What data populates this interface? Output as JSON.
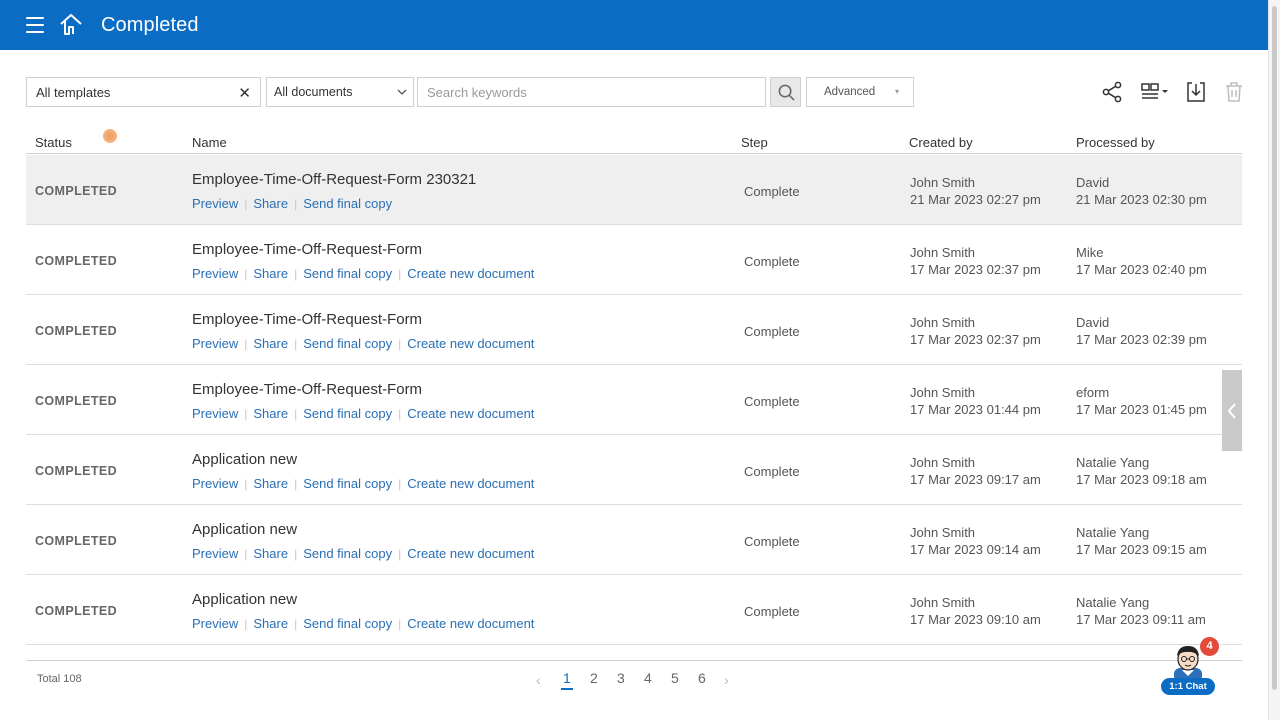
{
  "header": {
    "title": "Completed",
    "background": "#0b6cc4"
  },
  "filters": {
    "templates_value": "All templates",
    "clear_icon": "close-icon",
    "documents_value": "All documents",
    "search_placeholder": "Search keywords",
    "advanced_label": "Advanced"
  },
  "toolbar": {
    "icons": [
      "share-icon",
      "layout-view-icon",
      "download-icon",
      "trash-icon"
    ]
  },
  "table": {
    "columns": {
      "status": "Status",
      "name": "Name",
      "step": "Step",
      "created_by": "Created by",
      "processed_by": "Processed by"
    },
    "rows": [
      {
        "status": "COMPLETED",
        "name": "Employee-Time-Off-Request-Form 230321",
        "links": [
          "Preview",
          "Share",
          "Send final copy"
        ],
        "step": "Complete",
        "created_by": "John Smith",
        "created_at": "21 Mar 2023 02:27 pm",
        "processed_by": "David",
        "processed_at": "21 Mar 2023 02:30 pm"
      },
      {
        "status": "COMPLETED",
        "name": "Employee-Time-Off-Request-Form",
        "links": [
          "Preview",
          "Share",
          "Send final copy",
          "Create new document"
        ],
        "step": "Complete",
        "created_by": "John Smith",
        "created_at": "17 Mar 2023 02:37 pm",
        "processed_by": "Mike",
        "processed_at": "17 Mar 2023 02:40 pm"
      },
      {
        "status": "COMPLETED",
        "name": "Employee-Time-Off-Request-Form",
        "links": [
          "Preview",
          "Share",
          "Send final copy",
          "Create new document"
        ],
        "step": "Complete",
        "created_by": "John Smith",
        "created_at": "17 Mar 2023 02:37 pm",
        "processed_by": "David",
        "processed_at": "17 Mar 2023 02:39 pm"
      },
      {
        "status": "COMPLETED",
        "name": "Employee-Time-Off-Request-Form",
        "links": [
          "Preview",
          "Share",
          "Send final copy",
          "Create new document"
        ],
        "step": "Complete",
        "created_by": "John Smith",
        "created_at": "17 Mar 2023 01:44 pm",
        "processed_by": "eform",
        "processed_at": "17 Mar 2023 01:45 pm"
      },
      {
        "status": "COMPLETED",
        "name": "Application new",
        "links": [
          "Preview",
          "Share",
          "Send final copy",
          "Create new document"
        ],
        "step": "Complete",
        "created_by": "John Smith",
        "created_at": "17 Mar 2023 09:17 am",
        "processed_by": "Natalie Yang",
        "processed_at": "17 Mar 2023 09:18 am"
      },
      {
        "status": "COMPLETED",
        "name": "Application new",
        "links": [
          "Preview",
          "Share",
          "Send final copy",
          "Create new document"
        ],
        "step": "Complete",
        "created_by": "John Smith",
        "created_at": "17 Mar 2023 09:14 am",
        "processed_by": "Natalie Yang",
        "processed_at": "17 Mar 2023 09:15 am"
      },
      {
        "status": "COMPLETED",
        "name": "Application new",
        "links": [
          "Preview",
          "Share",
          "Send final copy",
          "Create new document"
        ],
        "step": "Complete",
        "created_by": "John Smith",
        "created_at": "17 Mar 2023 09:10 am",
        "processed_by": "Natalie Yang",
        "processed_at": "17 Mar 2023 09:11 am"
      }
    ]
  },
  "footer": {
    "total": "Total 108",
    "pages": [
      "1",
      "2",
      "3",
      "4",
      "5",
      "6"
    ],
    "current_page": "1"
  },
  "chat": {
    "label": "1:1 Chat",
    "badge": "4"
  },
  "colors": {
    "accent": "#0b6cc4",
    "link": "#2a6fb5",
    "badge": "#e24a3b"
  }
}
